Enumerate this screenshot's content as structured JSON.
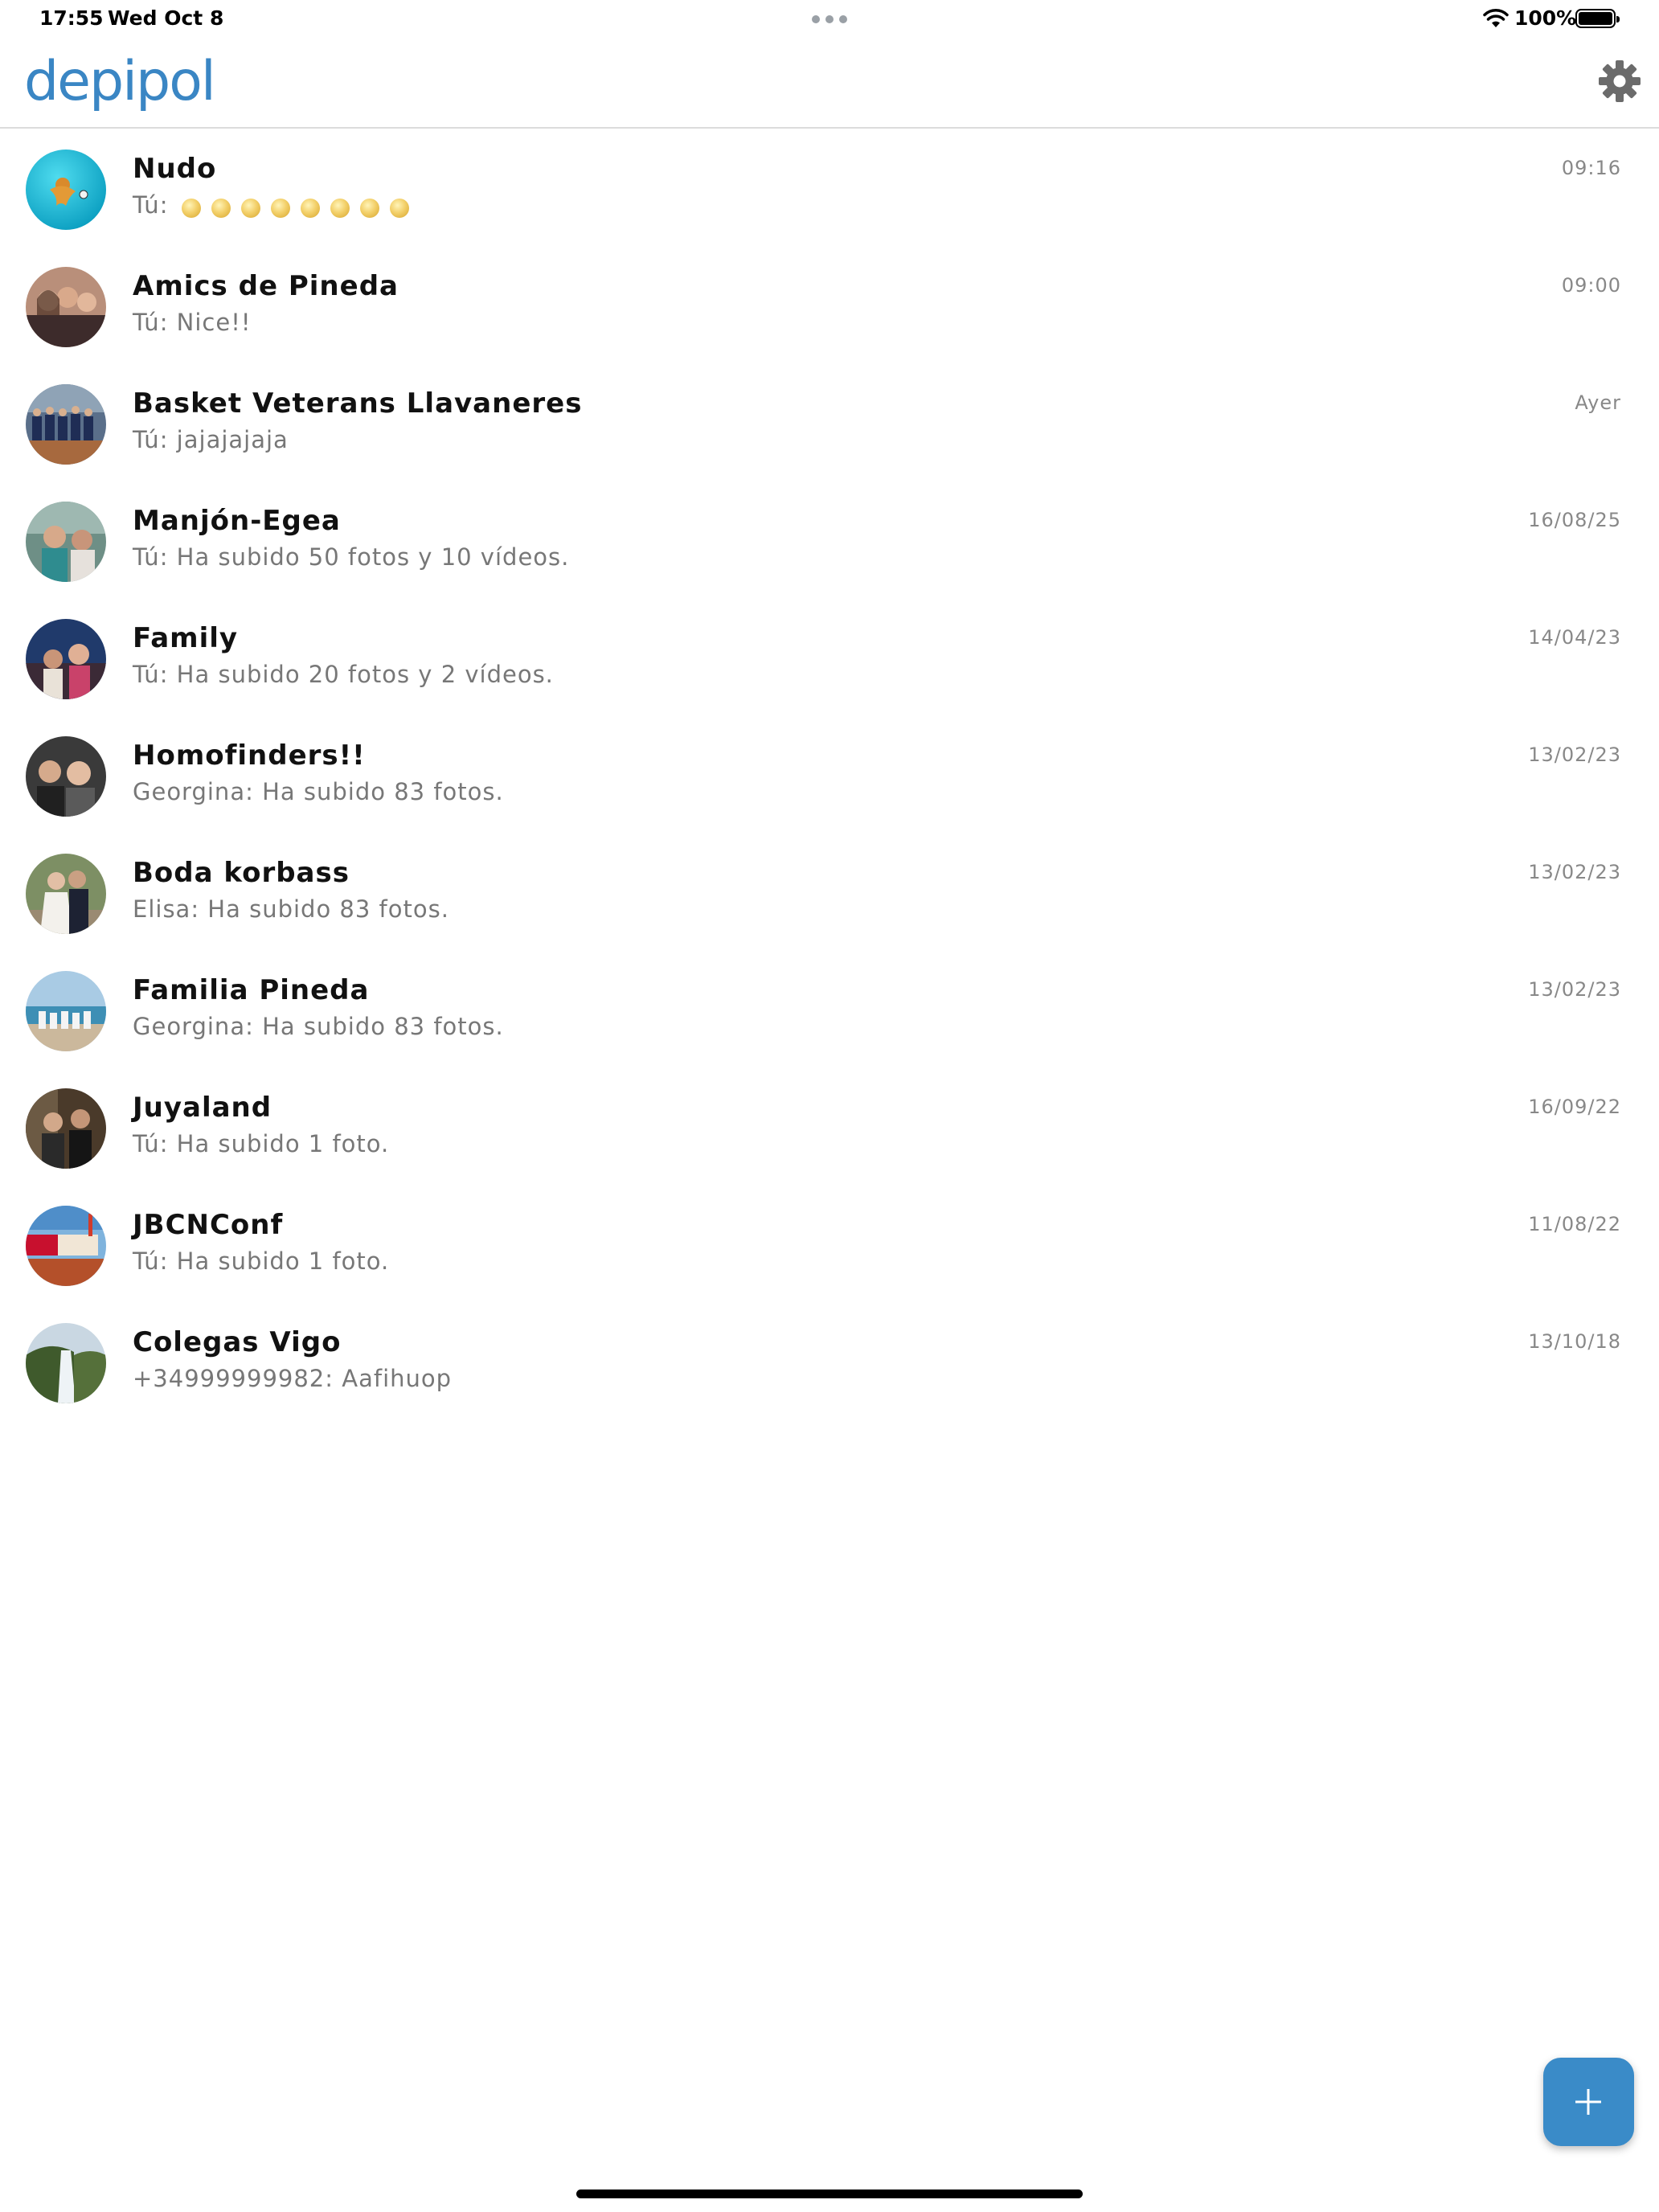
{
  "status_bar": {
    "time": "17:55",
    "date": "Wed Oct 8",
    "battery": "100%"
  },
  "header": {
    "logo": "depipol",
    "settings_icon": "gear-icon"
  },
  "chats": [
    {
      "name": "Nudo",
      "preview": "Tú:",
      "time": "09:16",
      "emoji_count": 8
    },
    {
      "name": "Amics de Pineda",
      "preview": "Tú: Nice!!",
      "time": "09:00"
    },
    {
      "name": "Basket Veterans Llavaneres",
      "preview": "Tú: jajajajaja",
      "time": "Ayer"
    },
    {
      "name": "Manjón-Egea",
      "preview": "Tú: Ha subido 50 fotos y 10 vídeos.",
      "time": "16/08/25"
    },
    {
      "name": "Family",
      "preview": "Tú: Ha subido 20 fotos y 2 vídeos.",
      "time": "14/04/23"
    },
    {
      "name": "Homofinders!!",
      "preview": "Georgina: Ha subido 83 fotos.",
      "time": "13/02/23"
    },
    {
      "name": "Boda korbass",
      "preview": "Elisa: Ha subido 83 fotos.",
      "time": "13/02/23"
    },
    {
      "name": "Familia Pineda",
      "preview": "Georgina: Ha subido 83 fotos.",
      "time": "13/02/23"
    },
    {
      "name": "Juyaland",
      "preview": "Tú: Ha subido 1 foto.",
      "time": "16/09/22"
    },
    {
      "name": "JBCNConf",
      "preview": "Tú: Ha subido 1 foto.",
      "time": "11/08/22"
    },
    {
      "name": "Colegas Vigo",
      "preview": "+34999999982: Aafihuop",
      "time": "13/10/18"
    }
  ],
  "fab": {
    "icon": "plus-icon"
  }
}
